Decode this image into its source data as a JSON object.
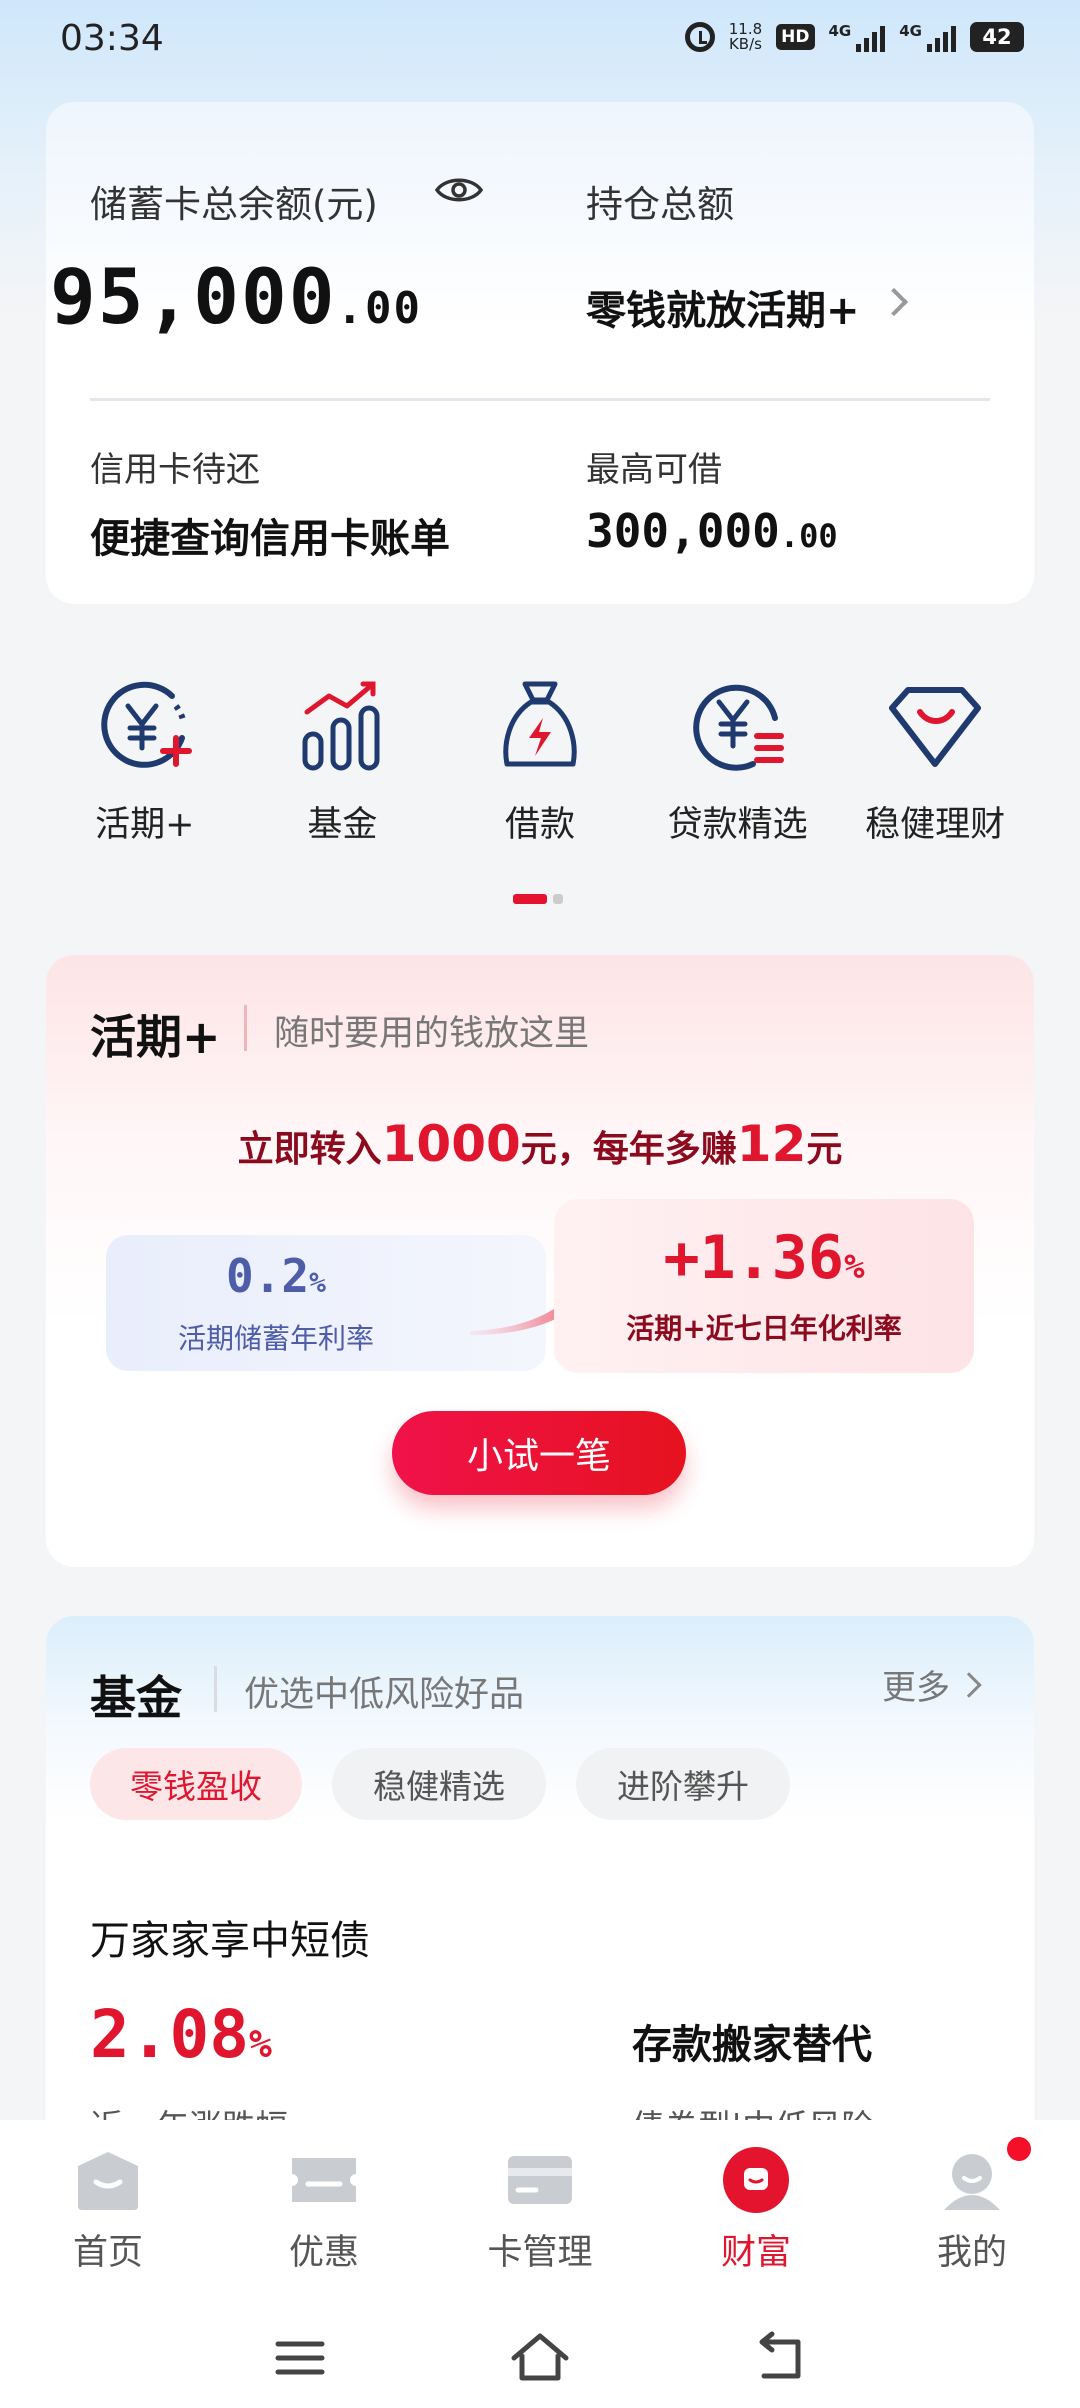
{
  "status_bar": {
    "time": "03:34",
    "speed_value": "11.8",
    "speed_unit": "KB/s",
    "hd": "HD",
    "net1": "4G",
    "net2": "4G",
    "battery": "42"
  },
  "summary": {
    "savings_label": "储蓄卡总余额(元)",
    "savings_amount_int": "95,000",
    "savings_amount_dec": ".00",
    "holdings_label": "持仓总额",
    "holdings_link": "零钱就放活期+",
    "credit_label": "信用卡待还",
    "credit_link": "便捷查询信用卡账单",
    "borrow_label": "最高可借",
    "borrow_amount_int": "300,000",
    "borrow_amount_dec": ".00"
  },
  "quick_actions": [
    {
      "label": "活期+",
      "icon": "yuan-plus-icon"
    },
    {
      "label": "基金",
      "icon": "bar-chart-icon"
    },
    {
      "label": "借款",
      "icon": "money-bag-icon"
    },
    {
      "label": "贷款精选",
      "icon": "yuan-list-icon"
    },
    {
      "label": "稳健理财",
      "icon": "shield-icon"
    }
  ],
  "huoqi": {
    "title": "活期+",
    "subtitle": "随时要用的钱放这里",
    "promo_a": "立即转入",
    "promo_amount": "1000",
    "promo_b": "元，每年多赚",
    "promo_earn": "12",
    "promo_c": "元",
    "base_rate": "0.2",
    "base_rate_unit": "%",
    "base_rate_label": "活期储蓄年利率",
    "plus_rate": "+1.36",
    "plus_rate_unit": "%",
    "plus_rate_label": "活期+近七日年化利率",
    "button": "小试一笔"
  },
  "fund": {
    "title": "基金",
    "subtitle": "优选中低风险好品",
    "more": "更多",
    "tabs": [
      "零钱盈收",
      "稳健精选",
      "进阶攀升"
    ],
    "product_name": "万家家享中短债",
    "rate": "2.08",
    "rate_unit": "%",
    "rate_caption": "近一年涨跌幅",
    "tag": "存款搬家替代",
    "description": "债券型|中低风险"
  },
  "bottom_nav": [
    {
      "label": "首页",
      "active": false
    },
    {
      "label": "优惠",
      "active": false
    },
    {
      "label": "卡管理",
      "active": false
    },
    {
      "label": "财富",
      "active": true
    },
    {
      "label": "我的",
      "active": false
    }
  ],
  "colors": {
    "brand_red": "#e0162e",
    "navy": "#1e3a6e",
    "fund_blue": "#4e5da8"
  }
}
